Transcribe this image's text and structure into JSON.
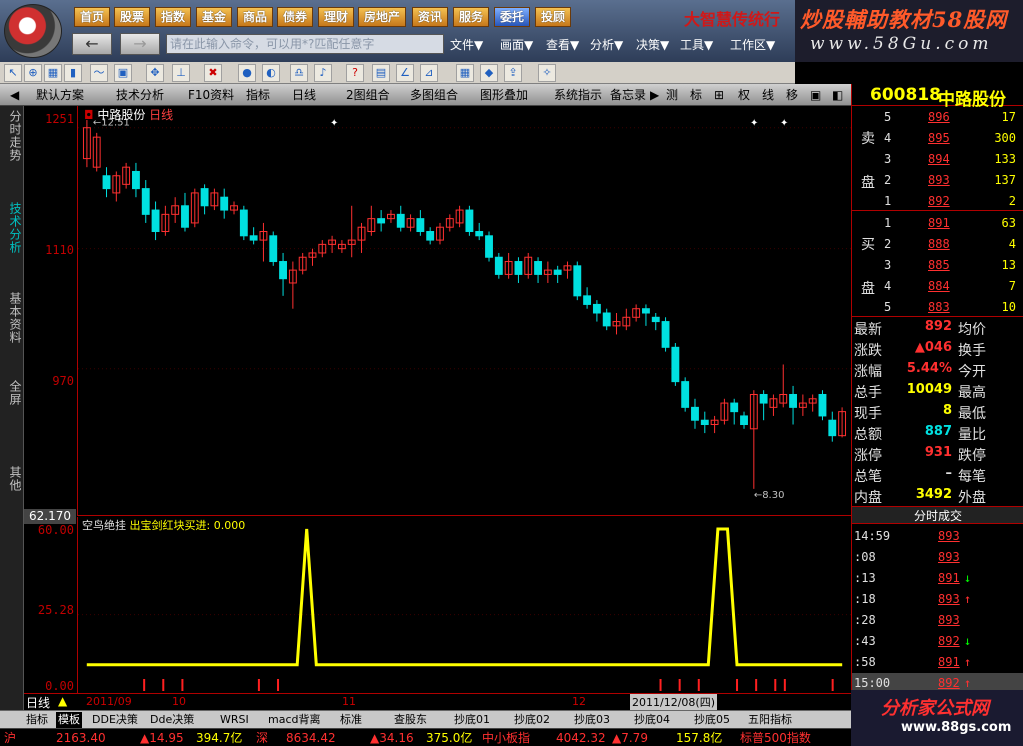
{
  "topbar": {
    "menu": [
      "首页",
      "股票",
      "指数",
      "基金",
      "商品",
      "债券",
      "理财",
      "房地产",
      "资讯",
      "服务",
      "委托",
      "投顾"
    ],
    "active_menu": "委托",
    "brand": "大智慧传统行",
    "command_placeholder": "请在此输入命令，可以用*?匹配任意字",
    "submenus": [
      "文件▼",
      "画面▼",
      "查看▼",
      "分析▼",
      "决策▼",
      "工具▼",
      "工作区▼"
    ],
    "watermark_title": "炒股輔助教材58股网",
    "watermark_url": "www.58Gu.com"
  },
  "tabbar": [
    "默认方案",
    "技术分析",
    "F10资料",
    "指标",
    "日线",
    "2图组合",
    "多图组合",
    "图形叠加",
    "系统指示",
    "备忘录",
    "测",
    "标",
    "权",
    "线",
    "移"
  ],
  "vtabs": [
    "分时走势",
    "技术分析",
    "基本资料",
    "全屏",
    "其他"
  ],
  "active_vtab": "技术分析",
  "kchart": {
    "title": "中路股份",
    "period": "日线",
    "high_label": "12.51",
    "low_label": "8.30",
    "axis_labels": [
      "1251",
      "1110",
      "970"
    ],
    "price_range": [
      8.1,
      12.6
    ],
    "candles": [
      [
        12.15,
        12.51,
        12.6,
        12.05
      ],
      [
        12.05,
        12.4,
        12.45,
        12.0
      ],
      [
        11.95,
        11.8,
        12.05,
        11.7
      ],
      [
        11.75,
        11.95,
        12.0,
        11.65
      ],
      [
        11.85,
        12.05,
        12.1,
        11.8
      ],
      [
        12.0,
        11.8,
        12.1,
        11.7
      ],
      [
        11.8,
        11.5,
        11.9,
        11.4
      ],
      [
        11.55,
        11.3,
        11.65,
        11.2
      ],
      [
        11.3,
        11.5,
        11.6,
        11.25
      ],
      [
        11.5,
        11.6,
        11.7,
        11.4
      ],
      [
        11.6,
        11.35,
        11.75,
        11.3
      ],
      [
        11.4,
        11.75,
        11.8,
        11.35
      ],
      [
        11.8,
        11.6,
        11.85,
        11.5
      ],
      [
        11.6,
        11.75,
        11.8,
        11.55
      ],
      [
        11.7,
        11.55,
        11.8,
        11.45
      ],
      [
        11.55,
        11.6,
        11.65,
        11.5
      ],
      [
        11.55,
        11.25,
        11.6,
        11.2
      ],
      [
        11.25,
        11.2,
        11.35,
        11.15
      ],
      [
        11.2,
        11.3,
        11.4,
        10.95
      ],
      [
        11.25,
        10.95,
        11.3,
        10.9
      ],
      [
        10.95,
        10.75,
        11.05,
        10.55
      ],
      [
        10.7,
        10.85,
        10.95,
        10.4
      ],
      [
        10.85,
        11.0,
        11.05,
        10.8
      ],
      [
        11.0,
        11.05,
        11.1,
        10.9
      ],
      [
        11.05,
        11.15,
        11.2,
        11.0
      ],
      [
        11.15,
        11.2,
        11.25,
        11.05
      ],
      [
        11.1,
        11.15,
        11.2,
        11.05
      ],
      [
        11.15,
        11.2,
        11.6,
        11.0
      ],
      [
        11.2,
        11.35,
        11.4,
        11.05
      ],
      [
        11.3,
        11.45,
        11.6,
        11.25
      ],
      [
        11.45,
        11.4,
        11.55,
        11.3
      ],
      [
        11.45,
        11.5,
        11.55,
        11.4
      ],
      [
        11.5,
        11.35,
        11.6,
        11.3
      ],
      [
        11.35,
        11.45,
        11.5,
        11.3
      ],
      [
        11.45,
        11.3,
        11.55,
        11.25
      ],
      [
        11.3,
        11.2,
        11.35,
        11.15
      ],
      [
        11.2,
        11.35,
        11.4,
        11.15
      ],
      [
        11.35,
        11.45,
        11.5,
        11.3
      ],
      [
        11.4,
        11.55,
        11.6,
        11.35
      ],
      [
        11.55,
        11.3,
        11.6,
        11.25
      ],
      [
        11.3,
        11.25,
        11.4,
        11.2
      ],
      [
        11.25,
        11.0,
        11.3,
        10.95
      ],
      [
        11.0,
        10.8,
        11.05,
        10.75
      ],
      [
        10.8,
        10.95,
        11.05,
        10.75
      ],
      [
        10.95,
        10.8,
        11.0,
        10.7
      ],
      [
        10.8,
        11.0,
        11.05,
        10.75
      ],
      [
        10.95,
        10.8,
        11.0,
        10.7
      ],
      [
        10.8,
        10.85,
        10.95,
        10.7
      ],
      [
        10.85,
        10.8,
        10.9,
        10.7
      ],
      [
        10.85,
        10.9,
        10.95,
        10.75
      ],
      [
        10.9,
        10.55,
        10.95,
        10.5
      ],
      [
        10.55,
        10.45,
        10.65,
        10.4
      ],
      [
        10.45,
        10.35,
        10.5,
        10.25
      ],
      [
        10.35,
        10.2,
        10.4,
        10.15
      ],
      [
        10.2,
        10.25,
        10.35,
        10.1
      ],
      [
        10.2,
        10.3,
        10.4,
        10.15
      ],
      [
        10.3,
        10.4,
        10.45,
        10.25
      ],
      [
        10.4,
        10.35,
        10.45,
        10.2
      ],
      [
        10.3,
        10.25,
        10.35,
        10.15
      ],
      [
        10.25,
        9.95,
        10.3,
        9.9
      ],
      [
        9.95,
        9.55,
        10.0,
        9.5
      ],
      [
        9.55,
        9.25,
        9.6,
        9.2
      ],
      [
        9.25,
        9.1,
        9.35,
        9.0
      ],
      [
        9.1,
        9.05,
        9.2,
        8.95
      ],
      [
        9.05,
        9.1,
        9.15,
        8.95
      ],
      [
        9.1,
        9.3,
        9.35,
        9.05
      ],
      [
        9.3,
        9.2,
        9.35,
        9.05
      ],
      [
        9.15,
        9.05,
        9.2,
        9.0
      ],
      [
        9.0,
        9.4,
        9.45,
        8.3
      ],
      [
        9.4,
        9.3,
        9.45,
        9.1
      ],
      [
        9.25,
        9.35,
        9.4,
        9.15
      ],
      [
        9.3,
        9.4,
        9.75,
        9.25
      ],
      [
        9.4,
        9.25,
        9.5,
        9.05
      ],
      [
        9.25,
        9.3,
        9.4,
        9.15
      ],
      [
        9.3,
        9.35,
        9.4,
        9.2
      ],
      [
        9.4,
        9.15,
        9.45,
        9.1
      ],
      [
        9.1,
        8.92,
        9.2,
        8.85
      ],
      [
        8.92,
        9.2,
        9.25,
        8.9
      ]
    ]
  },
  "ichart": {
    "title": "空鸟绝挂",
    "indicator_label": "出宝剑红块买进: 0.000",
    "axis_labels": [
      "60.00",
      "25.28",
      "0.00"
    ],
    "current_value": "62.170",
    "range": [
      0,
      60
    ],
    "series": [
      5,
      5,
      5,
      5,
      5,
      5,
      5,
      5,
      5,
      5,
      5,
      5,
      5,
      5,
      5,
      5,
      5,
      5,
      5,
      5,
      5,
      5,
      5,
      60,
      5,
      5,
      5,
      5,
      5,
      5,
      5,
      5,
      5,
      5,
      5,
      5,
      5,
      5,
      5,
      5,
      5,
      5,
      5,
      5,
      5,
      5,
      5,
      5,
      5,
      5,
      5,
      5,
      5,
      5,
      5,
      5,
      5,
      5,
      5,
      5,
      5,
      5,
      5,
      5,
      5,
      5,
      60,
      60,
      5,
      5,
      5,
      5,
      5,
      5,
      5,
      5,
      5,
      5,
      5,
      5
    ]
  },
  "datebar": {
    "label": "日线",
    "dates": [
      "2011/09",
      "10",
      "11",
      "12"
    ],
    "cursor_date": "2011/12/08(四)"
  },
  "bottom_tabs": [
    "指标",
    "模板",
    "DDE决策",
    "Dde决策",
    "WRSI",
    "macd背离",
    "标准",
    "查股东",
    "抄底01",
    "抄底02",
    "抄底03",
    "抄底04",
    "抄底05",
    "五阳指标"
  ],
  "active_bottom_tab": "模板",
  "ticker": [
    {
      "text": "沪",
      "color": "#ff3030"
    },
    {
      "text": "2163.40",
      "color": "#ff3030"
    },
    {
      "text": "▲14.95",
      "color": "#ff3030"
    },
    {
      "text": "394.7亿",
      "color": "#ffff00"
    },
    {
      "text": "深",
      "color": "#ff3030"
    },
    {
      "text": "8634.42",
      "color": "#ff3030"
    },
    {
      "text": "▲34.16",
      "color": "#ff3030"
    },
    {
      "text": "375.0亿",
      "color": "#ffff00"
    },
    {
      "text": "中小板指",
      "color": "#ff3030"
    },
    {
      "text": "4042.32",
      "color": "#ff3030"
    },
    {
      "text": "▲7.79",
      "color": "#ff3030"
    },
    {
      "text": "157.8亿",
      "color": "#ffff00"
    },
    {
      "text": "标普500指数",
      "color": "#ff3030"
    }
  ],
  "stock": {
    "code": "600818",
    "name": "中路股份",
    "sell_label_1": "卖",
    "sell_label_2": "盘",
    "buy_label_1": "买",
    "buy_label_2": "盘",
    "asks": [
      [
        "5",
        "896",
        "17"
      ],
      [
        "4",
        "895",
        "300"
      ],
      [
        "3",
        "894",
        "133"
      ],
      [
        "2",
        "893",
        "137"
      ],
      [
        "1",
        "892",
        "2"
      ]
    ],
    "bids": [
      [
        "1",
        "891",
        "63"
      ],
      [
        "2",
        "888",
        "4"
      ],
      [
        "3",
        "885",
        "13"
      ],
      [
        "4",
        "884",
        "7"
      ],
      [
        "5",
        "883",
        "10"
      ]
    ],
    "stats": [
      [
        "最新",
        "892",
        "均价",
        ""
      ],
      [
        "涨跌",
        "▲046",
        "换手",
        ""
      ],
      [
        "涨幅",
        "5.44%",
        "今开",
        ""
      ],
      [
        "总手",
        "10049",
        "最高",
        ""
      ],
      [
        "现手",
        "8",
        "最低",
        ""
      ],
      [
        "总额",
        "887",
        "量比",
        ""
      ],
      [
        "涨停",
        "931",
        "跌停",
        ""
      ],
      [
        "总笔",
        "–",
        "每笔",
        ""
      ],
      [
        "内盘",
        "3492",
        "外盘",
        ""
      ]
    ],
    "trades_title": "分时成交",
    "trades": [
      [
        "14:59",
        "893",
        ""
      ],
      [
        ":08",
        "893",
        ""
      ],
      [
        ":13",
        "891",
        "↓"
      ],
      [
        ":18",
        "893",
        "↑"
      ],
      [
        ":28",
        "893",
        ""
      ],
      [
        ":43",
        "892",
        "↓"
      ],
      [
        ":58",
        "891",
        "↑"
      ],
      [
        "15:00",
        "892",
        "↑"
      ]
    ]
  },
  "footer_logo": "分析家公式网",
  "footer_url": "www.88gs.com"
}
